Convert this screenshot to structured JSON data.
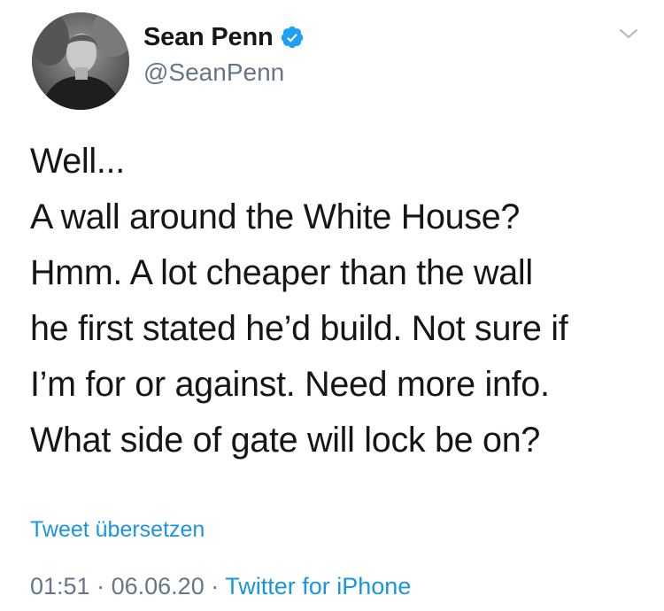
{
  "author": {
    "display_name": "Sean Penn",
    "handle": "@SeanPenn",
    "verified": true
  },
  "tweet": {
    "lines": [
      "Well...",
      "A wall around the White House?",
      "Hmm. A lot cheaper than the wall",
      "he first stated he’d build. Not sure if",
      "I’m for or against. Need more info.",
      "What side of gate will lock be on?"
    ],
    "translate_label": "Tweet übersetzen",
    "time": "01:51",
    "date": "06.06.20",
    "separator": "·",
    "source": "Twitter for iPhone"
  },
  "icons": {
    "verified": "verified-badge-icon",
    "menu": "chevron-down-icon"
  },
  "colors": {
    "link": "#1b95e0",
    "secondary": "#657786",
    "text": "#14171a"
  }
}
